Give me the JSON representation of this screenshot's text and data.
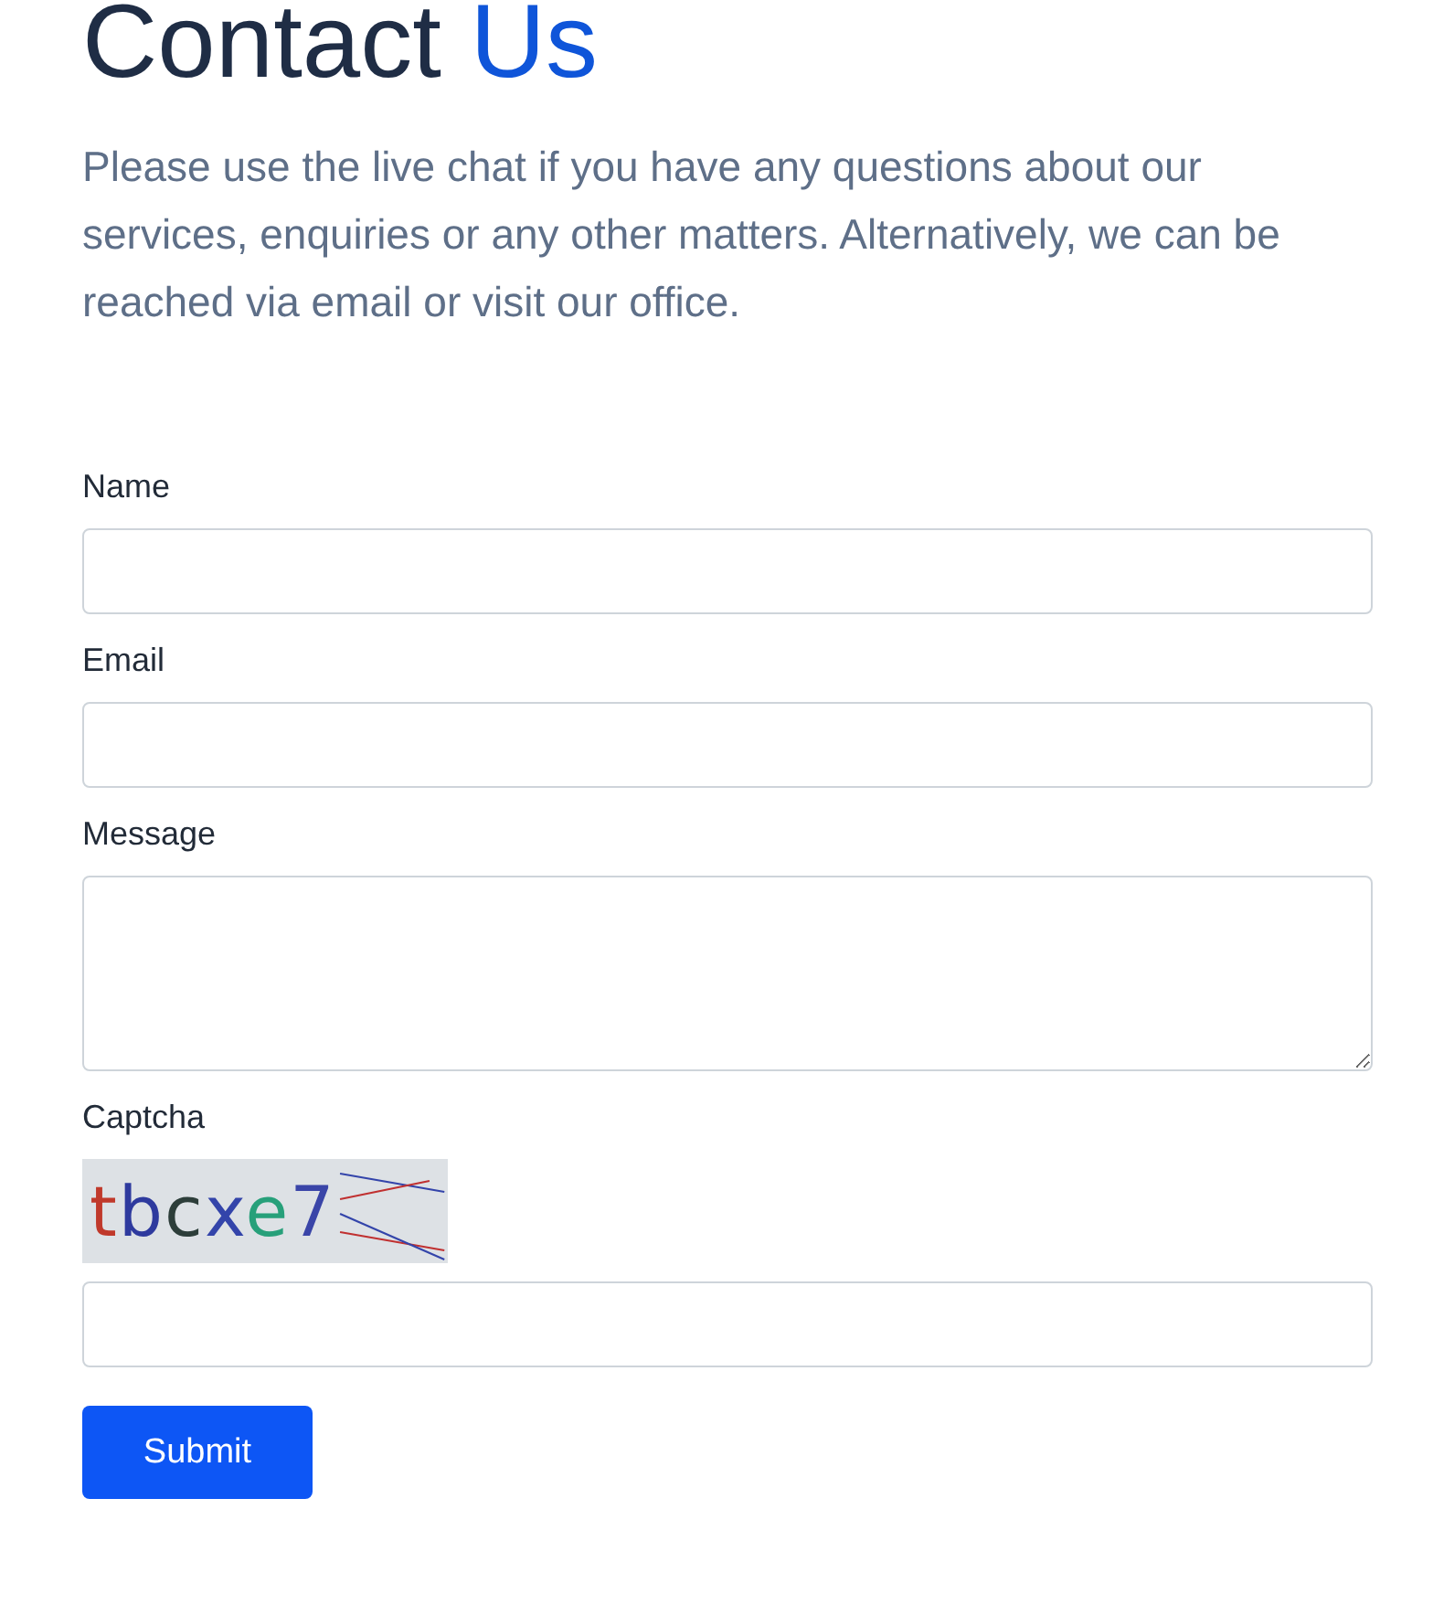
{
  "heading": {
    "text": "Contact",
    "highlight": "Us"
  },
  "intro": "Please use the live chat if you have any questions about our services, enquiries or any other matters. Alternatively, we can be reached via email or visit our office.",
  "fields": [
    {
      "label": "Name",
      "kind": "input"
    },
    {
      "label": "Email",
      "kind": "input"
    },
    {
      "label": "Message",
      "kind": "textarea"
    }
  ],
  "captcha": {
    "label": "Captcha",
    "characters": [
      {
        "text": "t",
        "color": "#c0392b"
      },
      {
        "text": "b",
        "color": "#2e3a9e"
      },
      {
        "text": "c",
        "color": "#2d3e3a"
      },
      {
        "text": "x",
        "color": "#3344aa"
      },
      {
        "text": "e",
        "color": "#27a07a"
      },
      {
        "text": "7",
        "color": "#3a45a8"
      }
    ]
  },
  "submit": "Submit"
}
